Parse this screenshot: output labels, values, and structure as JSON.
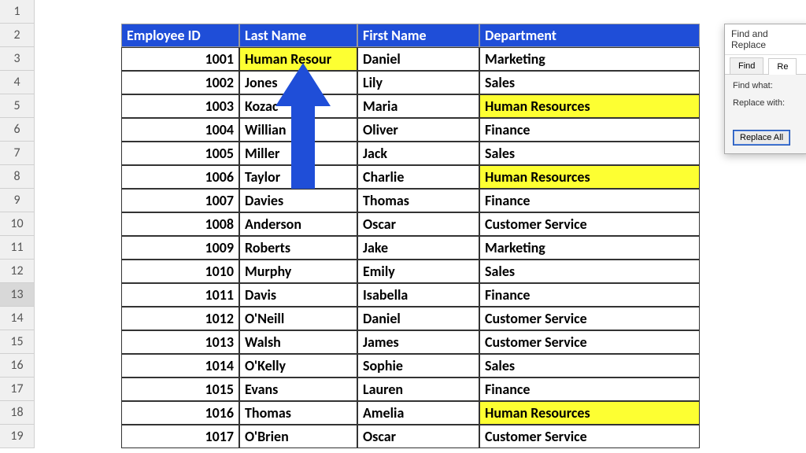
{
  "headers": {
    "emp_id": "Employee ID",
    "last": "Last Name",
    "first": "First Name",
    "dept": "Department"
  },
  "rows": [
    {
      "num": "1",
      "id": "",
      "last": "",
      "first": "",
      "dept": "",
      "blank": true
    },
    {
      "num": "2",
      "id": "",
      "last": "",
      "first": "",
      "dept": "",
      "hdr": true
    },
    {
      "num": "3",
      "id": "1001",
      "last": "Human Resour",
      "first": "Daniel",
      "dept": "Marketing",
      "hl_last": true
    },
    {
      "num": "4",
      "id": "1002",
      "last": "Jones",
      "first": "Lily",
      "dept": "Sales"
    },
    {
      "num": "5",
      "id": "1003",
      "last": "Kozac",
      "first": "Maria",
      "dept": "Human Resources",
      "hl_dept": true
    },
    {
      "num": "6",
      "id": "1004",
      "last": "Willian",
      "first": "Oliver",
      "dept": "Finance"
    },
    {
      "num": "7",
      "id": "1005",
      "last": "Miller",
      "first": "Jack",
      "dept": "Sales"
    },
    {
      "num": "8",
      "id": "1006",
      "last": "Taylor",
      "first": "Charlie",
      "dept": "Human Resources",
      "hl_dept": true
    },
    {
      "num": "9",
      "id": "1007",
      "last": "Davies",
      "first": "Thomas",
      "dept": "Finance"
    },
    {
      "num": "10",
      "id": "1008",
      "last": "Anderson",
      "first": "Oscar",
      "dept": "Customer Service"
    },
    {
      "num": "11",
      "id": "1009",
      "last": "Roberts",
      "first": "Jake",
      "dept": "Marketing"
    },
    {
      "num": "12",
      "id": "1010",
      "last": "Murphy",
      "first": "Emily",
      "dept": "Sales"
    },
    {
      "num": "13",
      "id": "1011",
      "last": "Davis",
      "first": "Isabella",
      "dept": "Finance",
      "sel": true
    },
    {
      "num": "14",
      "id": "1012",
      "last": "O'Neill",
      "first": "Daniel",
      "dept": "Customer Service"
    },
    {
      "num": "15",
      "id": "1013",
      "last": "Walsh",
      "first": "James",
      "dept": "Customer Service"
    },
    {
      "num": "16",
      "id": "1014",
      "last": "O'Kelly",
      "first": "Sophie",
      "dept": "Sales"
    },
    {
      "num": "17",
      "id": "1015",
      "last": "Evans",
      "first": "Lauren",
      "dept": "Finance"
    },
    {
      "num": "18",
      "id": "1016",
      "last": "Thomas",
      "first": "Amelia",
      "dept": "Human Resources",
      "hl_dept": true
    },
    {
      "num": "19",
      "id": "1017",
      "last": "O'Brien",
      "first": "Oscar",
      "dept": "Customer Service"
    }
  ],
  "dialog": {
    "title": "Find and Replace",
    "tab_find": "Find",
    "tab_replace": "Re",
    "find_label": "Find what:",
    "replace_label": "Replace with:",
    "btn_replace_all": "Replace All"
  }
}
